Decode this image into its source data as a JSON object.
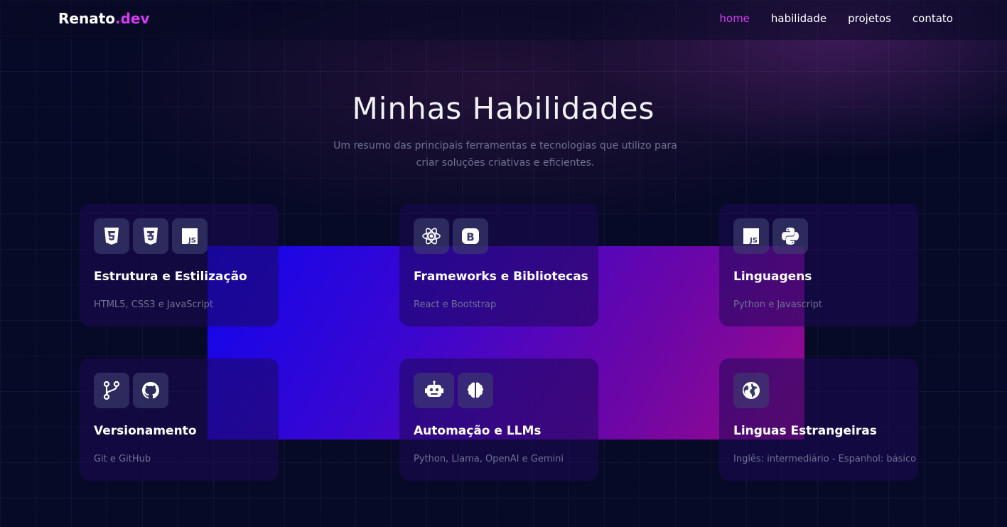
{
  "brand": {
    "name": "Renato",
    "suffix": ".dev",
    "accent_color": "#d63cf2"
  },
  "nav": [
    {
      "label": "home",
      "active": true
    },
    {
      "label": "habilidade",
      "active": false
    },
    {
      "label": "projetos",
      "active": false
    },
    {
      "label": "contato",
      "active": false
    }
  ],
  "section": {
    "title": "Minhas Habilidades",
    "subtitle": "Um resumo das principais ferramentas e tecnologias que utilizo para criar soluções criativas e eficientes."
  },
  "cards": [
    {
      "title": "Estrutura e Estilização",
      "description": "HTML5, CSS3 e JavaScript",
      "icons": [
        "html5-icon",
        "css3-icon",
        "javascript-icon"
      ]
    },
    {
      "title": "Frameworks e Bibliotecas",
      "description": "React e Bootstrap",
      "icons": [
        "react-icon",
        "bootstrap-icon"
      ]
    },
    {
      "title": "Linguagens",
      "description": "Python e Javascript",
      "icons": [
        "javascript-icon",
        "python-icon"
      ]
    },
    {
      "title": "Versionamento",
      "description": "Git e GitHub",
      "icons": [
        "git-branch-icon",
        "github-icon"
      ]
    },
    {
      "title": "Automação e LLMs",
      "description": "Python, Llama, OpenAI e Gemini",
      "icons": [
        "robot-icon",
        "brain-icon"
      ]
    },
    {
      "title": "Linguas Estrangeiras",
      "description": "Inglês: intermediário - Espanhol: básico",
      "icons": [
        "globe-icon"
      ]
    }
  ]
}
